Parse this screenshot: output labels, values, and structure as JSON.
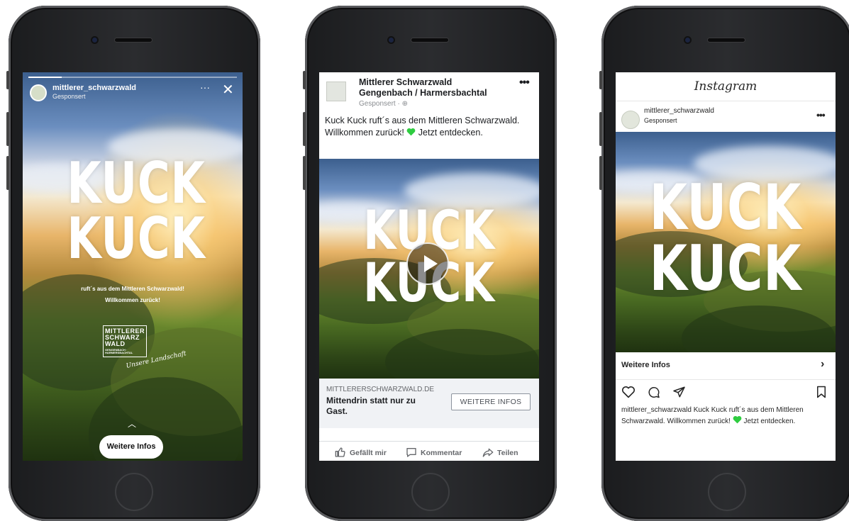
{
  "story": {
    "username": "mittlerer_schwarzwald",
    "sponsored": "Gesponsert",
    "more": "···",
    "close": "✕",
    "headline_line1": "KUCK",
    "headline_line2": "KUCK",
    "tagline_line1": "ruft´s aus dem Mittleren Schwarzwald!",
    "tagline_line2": "Willkommen zurück!",
    "logo_line1": "MITTLERER",
    "logo_line2": "SCHWARZ",
    "logo_line3": "WALD",
    "logo_small": "GENGENBACH · HARMERSBACHTAL",
    "logo_script": "Unsere Landschaft",
    "swipe": "︿",
    "cta": "Weitere Infos"
  },
  "facebook": {
    "page_name": "Mittlerer Schwarzwald Gengenbach / Harmersbachtal",
    "sponsored": "Gesponsert · ⊕",
    "more": "•••",
    "post_text_before": "Kuck Kuck ruft´s aus dem Mittleren Schwarzwald. Willkommen zurück!",
    "post_text_after": " Jetzt entdecken.",
    "headline_line1": "KUCK",
    "headline_line2": "KUCK",
    "link_url": "MITTLERERSCHWARZWALD.DE",
    "link_headline": "Mittendrin statt nur zu Gast.",
    "cta": "WEITERE INFOS",
    "actions": [
      "Gefällt mir",
      "Kommentar",
      "Teilen"
    ]
  },
  "instagram": {
    "app_title": "Instagram",
    "username": "mittlerer_schwarzwald",
    "sponsored": "Gesponsert",
    "more": "•••",
    "headline_line1": "KUCK",
    "headline_line2": "KUCK",
    "cta": "Weitere Infos",
    "cta_chevron": "›",
    "caption_before": "mittlerer_schwarzwald Kuck Kuck ruft´s aus dem Mittleren Schwarzwald. Willkommen zurück!",
    "caption_after": " Jetzt entdecken."
  },
  "colors": {
    "heart": "#2ecc40",
    "phone_body": "#1b1c1e"
  }
}
